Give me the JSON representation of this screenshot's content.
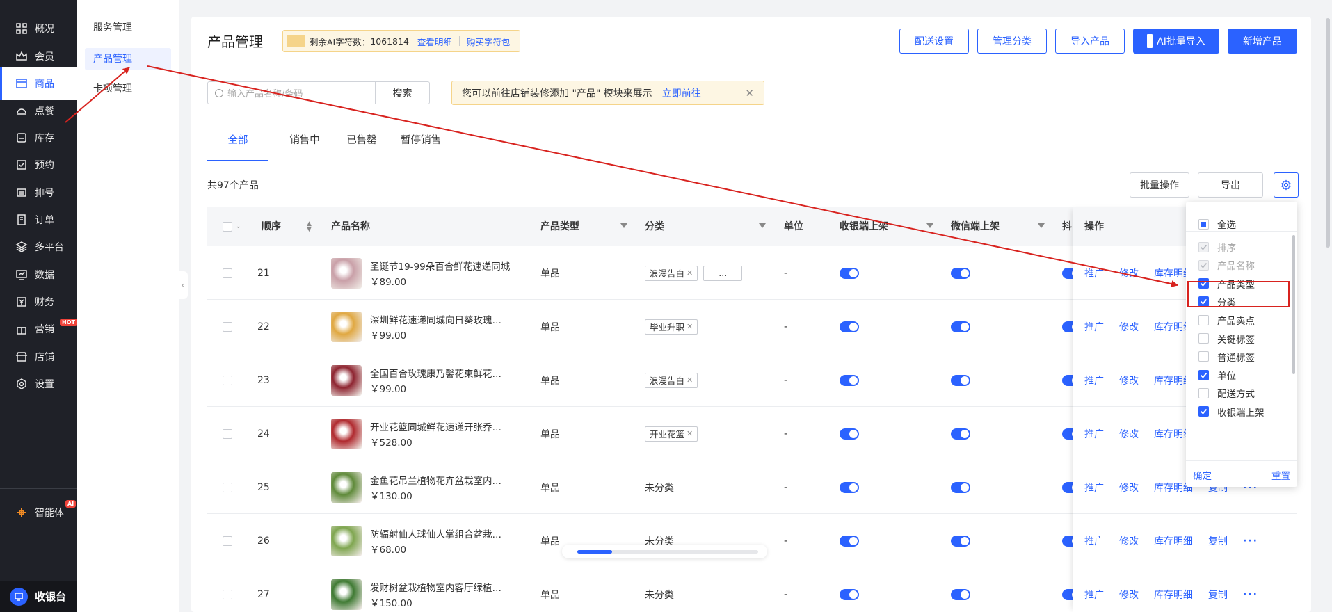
{
  "nav": {
    "items": [
      {
        "label": "概况",
        "icon": "grid-icon"
      },
      {
        "label": "会员",
        "icon": "crown-icon"
      },
      {
        "label": "商品",
        "icon": "shop-icon"
      },
      {
        "label": "点餐",
        "icon": "cloche-icon"
      },
      {
        "label": "库存",
        "icon": "inventory-icon"
      },
      {
        "label": "预约",
        "icon": "calendar-check-icon"
      },
      {
        "label": "排号",
        "icon": "queue-icon"
      },
      {
        "label": "订单",
        "icon": "order-icon"
      },
      {
        "label": "多平台",
        "icon": "layers-icon"
      },
      {
        "label": "数据",
        "icon": "chart-icon"
      },
      {
        "label": "财务",
        "icon": "finance-icon"
      },
      {
        "label": "营销",
        "icon": "gift-icon",
        "badge": "HOT"
      },
      {
        "label": "店铺",
        "icon": "store-icon"
      },
      {
        "label": "设置",
        "icon": "settings-icon"
      }
    ],
    "agent": {
      "label": "智能体",
      "badge": "AI"
    },
    "cashier": "收银台"
  },
  "subnav": {
    "items": [
      "服务管理",
      "产品管理",
      "卡项管理"
    ]
  },
  "header": {
    "title": "产品管理",
    "ai_quota_label": "剩余AI字符数：",
    "ai_quota_value": "1061814",
    "view_detail": "查看明细",
    "buy_pack": "购买字符包",
    "buttons": {
      "delivery": "配送设置",
      "manage_category": "管理分类",
      "import": "导入产品",
      "ai_import": "AI批量导入",
      "add": "新增产品"
    }
  },
  "search": {
    "placeholder": "输入产品名称/条码",
    "button": "搜索"
  },
  "notice": {
    "text": "您可以前往店铺装修添加 \"产品\" 模块来展示",
    "link": "立即前往"
  },
  "tabs": [
    "全部",
    "销售中",
    "已售罄",
    "暂停销售"
  ],
  "list": {
    "count": "共97个产品",
    "batch": "批量操作",
    "export": "导出"
  },
  "table": {
    "headers": {
      "order": "顺序",
      "name": "产品名称",
      "type": "产品类型",
      "category": "分类",
      "unit": "单位",
      "pos": "收银端上架",
      "wechat": "微信端上架",
      "douyin": "抖",
      "ops": "操作"
    },
    "ops": {
      "promote": "推广",
      "edit": "修改",
      "stock": "库存明细",
      "copy": "复制",
      "more": "···"
    },
    "rows": [
      {
        "order": "21",
        "name": "圣诞节19-99朵百合鲜花速递同城",
        "price": "￥89.00",
        "type": "单品",
        "tags": [
          "浪漫告白",
          "..."
        ],
        "unit": "-",
        "thumb": "#c9a0a8"
      },
      {
        "order": "22",
        "name": "深圳鲜花速递同城向日葵玫瑰…",
        "price": "￥99.00",
        "type": "单品",
        "tags": [
          "毕业升职"
        ],
        "unit": "-",
        "thumb": "#e0a842"
      },
      {
        "order": "23",
        "name": "全国百合玫瑰康乃馨花束鲜花…",
        "price": "￥99.00",
        "type": "单品",
        "tags": [
          "浪漫告白"
        ],
        "unit": "-",
        "thumb": "#8e2430"
      },
      {
        "order": "24",
        "name": "开业花篮同城鲜花速递开张乔…",
        "price": "￥528.00",
        "type": "单品",
        "tags": [
          "开业花篮"
        ],
        "unit": "-",
        "thumb": "#b02a2f"
      },
      {
        "order": "25",
        "name": "金鱼花吊兰植物花卉盆栽室内…",
        "price": "￥130.00",
        "type": "单品",
        "category_text": "未分类",
        "unit": "-",
        "thumb": "#5f8a3a"
      },
      {
        "order": "26",
        "name": "防辐射仙人球仙人掌组合盆栽…",
        "price": "￥68.00",
        "type": "单品",
        "category_text": "未分类",
        "unit": "-",
        "thumb": "#7fa650"
      },
      {
        "order": "27",
        "name": "发财树盆栽植物室内客厅绿植…",
        "price": "￥150.00",
        "type": "单品",
        "category_text": "未分类",
        "unit": "-",
        "thumb": "#3f7a33"
      }
    ]
  },
  "column_settings": {
    "select_all": "全选",
    "items": [
      {
        "label": "排序",
        "state": "disabled"
      },
      {
        "label": "产品名称",
        "state": "disabled"
      },
      {
        "label": "产品类型",
        "state": "on"
      },
      {
        "label": "分类",
        "state": "on"
      },
      {
        "label": "产品卖点",
        "state": "off"
      },
      {
        "label": "关键标签",
        "state": "off"
      },
      {
        "label": "普通标签",
        "state": "off"
      },
      {
        "label": "单位",
        "state": "on"
      },
      {
        "label": "配送方式",
        "state": "off"
      },
      {
        "label": "收银端上架",
        "state": "on"
      }
    ],
    "confirm": "确定",
    "reset": "重置"
  },
  "colors": {
    "accent": "#2b62ff",
    "nav_bg": "#1f2128",
    "annotation": "#d8231f"
  }
}
